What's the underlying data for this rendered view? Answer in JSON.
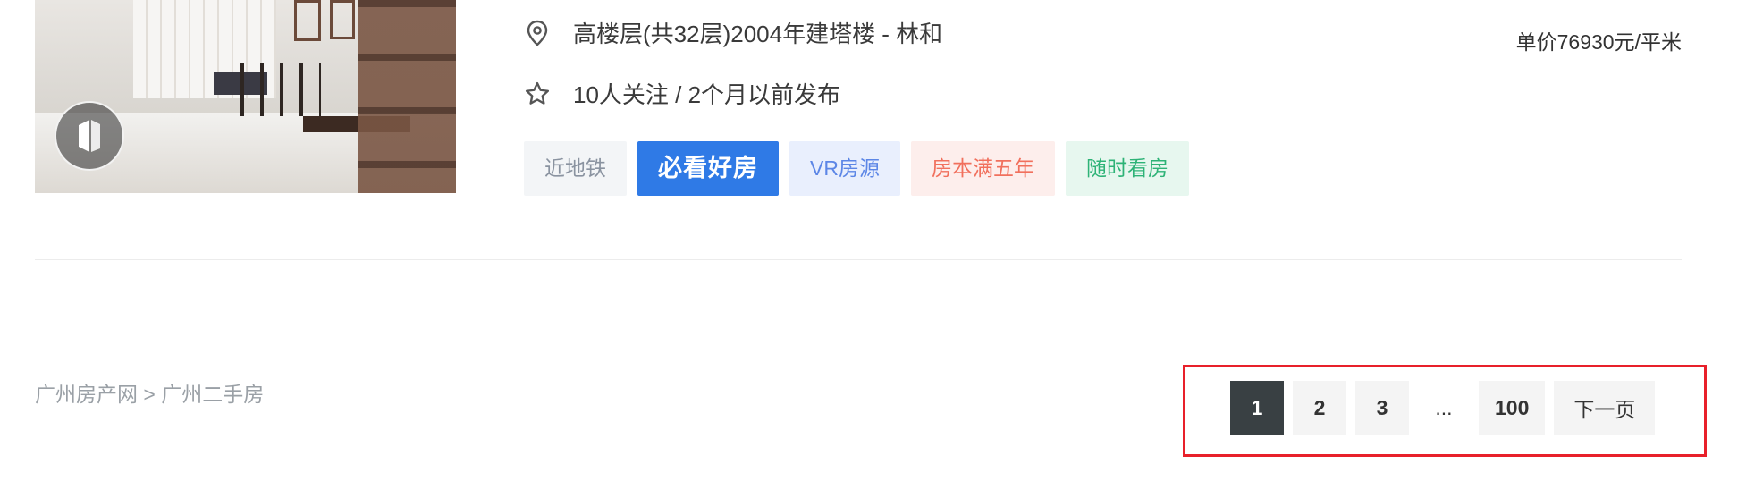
{
  "listing": {
    "location": "高楼层(共32层)2004年建塔楼 - 林和",
    "followers": "10人关注 / 2个月以前发布",
    "unit_price": "单价76930元/平米",
    "tags": [
      "近地铁",
      "必看好房",
      "VR房源",
      "房本满五年",
      "随时看房"
    ]
  },
  "breadcrumb": {
    "home": "广州房产网",
    "sep": ">",
    "current": "广州二手房"
  },
  "pagination": {
    "pages": [
      "1",
      "2",
      "3",
      "...",
      "100"
    ],
    "next": "下一页"
  },
  "icons": {
    "location": "location-pin-icon",
    "star": "star-outline-icon",
    "badge": "vr-logo-icon"
  },
  "colors": {
    "active_page": "#394043",
    "highlight_border": "#e8202a",
    "tag_blue": "#2f7ae6"
  }
}
